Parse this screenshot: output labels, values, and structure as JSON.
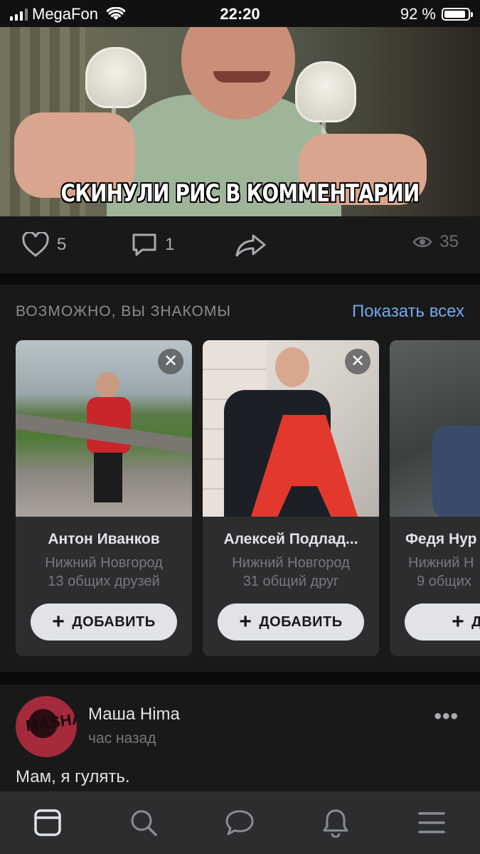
{
  "status_bar": {
    "carrier": "MegaFon",
    "time": "22:20",
    "battery_text": "92 %",
    "battery_level": 0.92
  },
  "meme_post": {
    "caption": "СКИНУЛИ РИС В КОММЕНТАРИИ",
    "likes": "5",
    "comments": "1",
    "views": "35"
  },
  "friends_section": {
    "title": "ВОЗМОЖНО, ВЫ ЗНАКОМЫ",
    "show_all": "Показать всех",
    "cards": [
      {
        "name": "Антон Иванков",
        "city": "Нижний Новгород",
        "mutual": "13 общих друзей",
        "add_label": "ДОБАВИТЬ"
      },
      {
        "name": "Алексей Подлад...",
        "city": "Нижний Новгород",
        "mutual": "31 общий друг",
        "add_label": "ДОБАВИТЬ"
      },
      {
        "name": "Федя Нур",
        "city": "Нижний Н",
        "mutual": "9 общих",
        "add_label": "ДОБ"
      }
    ]
  },
  "post": {
    "author": "Маша Hima",
    "time": "час назад",
    "text": "Мам, я гулять.",
    "more": "•••"
  },
  "tabbar": {
    "items": [
      "news-icon",
      "search-icon",
      "messages-icon",
      "notifications-icon",
      "menu-icon"
    ]
  },
  "colors": {
    "background": "#19191a",
    "accent_link": "#71aaeb",
    "button_bg": "#e1e3e6"
  }
}
